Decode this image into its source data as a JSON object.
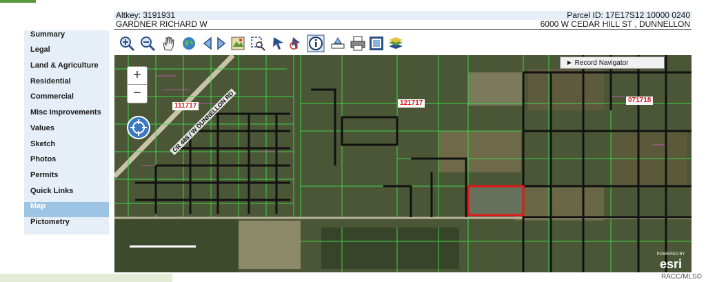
{
  "header": {
    "title": ""
  },
  "info": {
    "altkey": "Altkey: 3191931",
    "parcel_id": "Parcel ID: 17E17S12 10000 0240",
    "owner": "GARDNER RICHARD W",
    "address": "6000 W CEDAR HILL ST , DUNNELLON"
  },
  "sidebar": {
    "items": [
      {
        "label": "Summary"
      },
      {
        "label": "Legal"
      },
      {
        "label": "Land & Agriculture"
      },
      {
        "label": "Residential"
      },
      {
        "label": "Commercial"
      },
      {
        "label": "Misc Improvements"
      },
      {
        "label": "Values"
      },
      {
        "label": "Sketch"
      },
      {
        "label": "Photos"
      },
      {
        "label": "Permits"
      },
      {
        "label": "Quick Links"
      },
      {
        "label": "Map"
      },
      {
        "label": "Pictometry"
      }
    ],
    "active": "Map"
  },
  "toolbar": {
    "tools": [
      "zoom-in-icon",
      "zoom-out-icon",
      "pan-hand-icon",
      "globe-icon",
      "previous-extent-icon",
      "next-extent-icon",
      "full-extent-icon",
      "select-icon",
      "identify-icon",
      "measure-icon",
      "info-icon",
      "buffer-icon",
      "print-icon",
      "export-icon",
      "layers-icon"
    ]
  },
  "map": {
    "zoom_in": "+",
    "zoom_out": "−",
    "record_navigator": "► Record Navigator",
    "labels": [
      "111717",
      "121717",
      "071718"
    ],
    "road_label": "CR 488 / W DUNNELLON RD",
    "esri_small": "POWERED BY",
    "esri": "esri"
  },
  "footer": {
    "credit": "RACC/MLS©"
  },
  "colors": {
    "sidebar_bg": "#e6eef7",
    "active_item": "#9ec4e3",
    "parcel_line": "#3fd24a",
    "selected_parcel": "#e01818"
  }
}
